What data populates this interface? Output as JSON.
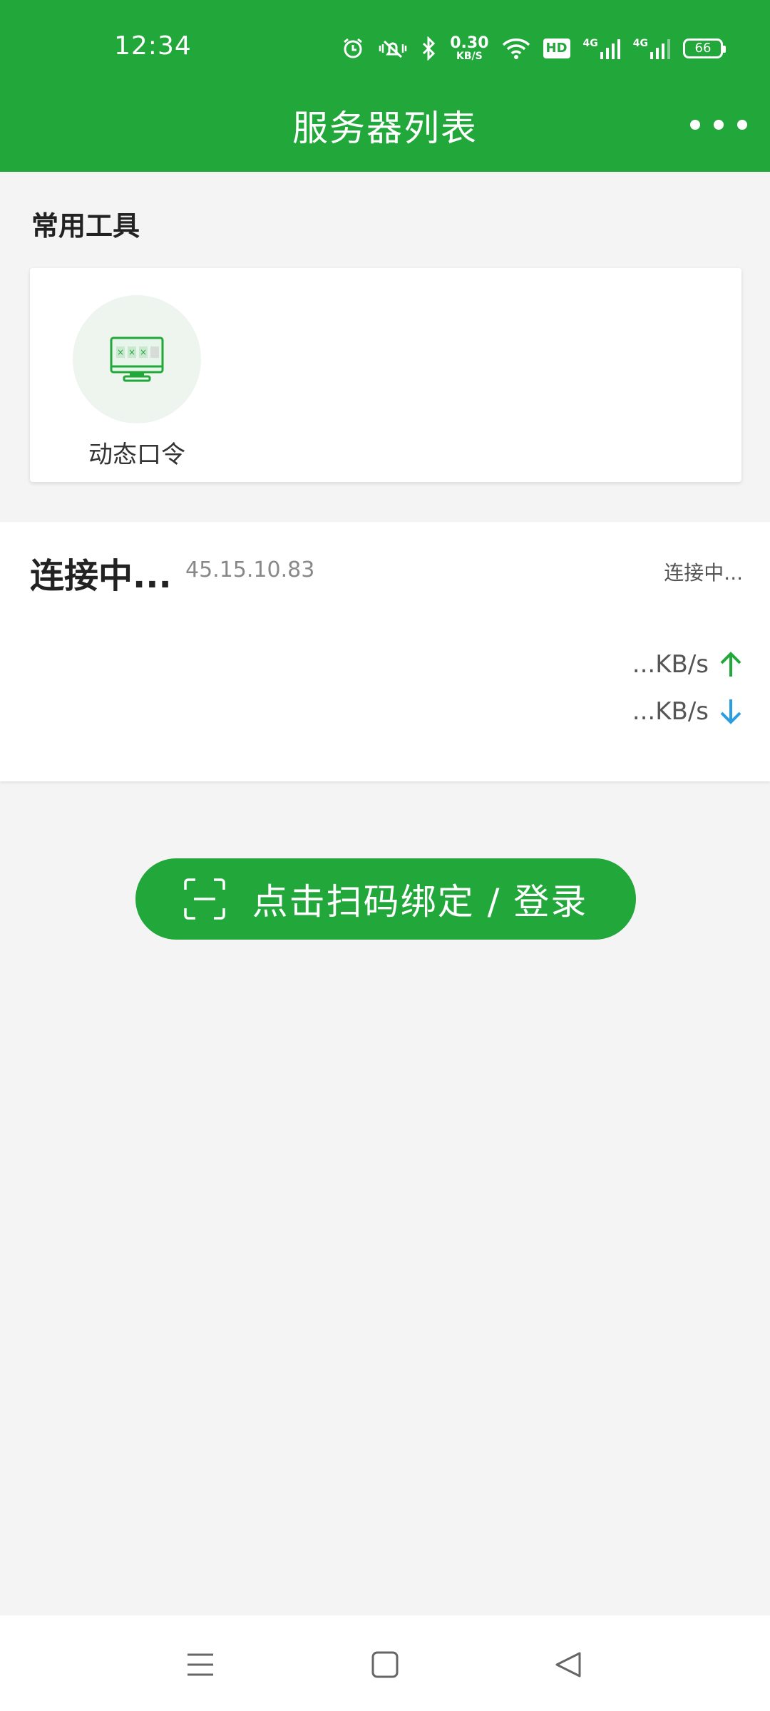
{
  "status_bar": {
    "time": "12:34",
    "net_speed_value": "0.30",
    "net_speed_unit": "KB/S",
    "hd_label": "HD",
    "signal_1": "4G",
    "signal_2": "4G",
    "battery": "66"
  },
  "header": {
    "title": "服务器列表"
  },
  "tools": {
    "section_title": "常用工具",
    "items": [
      {
        "label": "动态口令",
        "icon": "monitor-password-icon"
      }
    ]
  },
  "server": {
    "name": "连接中...",
    "ip": "45.15.10.83",
    "status": "连接中...",
    "upload_speed": "...KB/s",
    "download_speed": "...KB/s"
  },
  "scan_button": {
    "label": "点击扫码绑定 / 登录"
  },
  "colors": {
    "brand_green": "#22a73b",
    "upload_arrow": "#22a73b",
    "download_arrow": "#2b9ee0"
  }
}
